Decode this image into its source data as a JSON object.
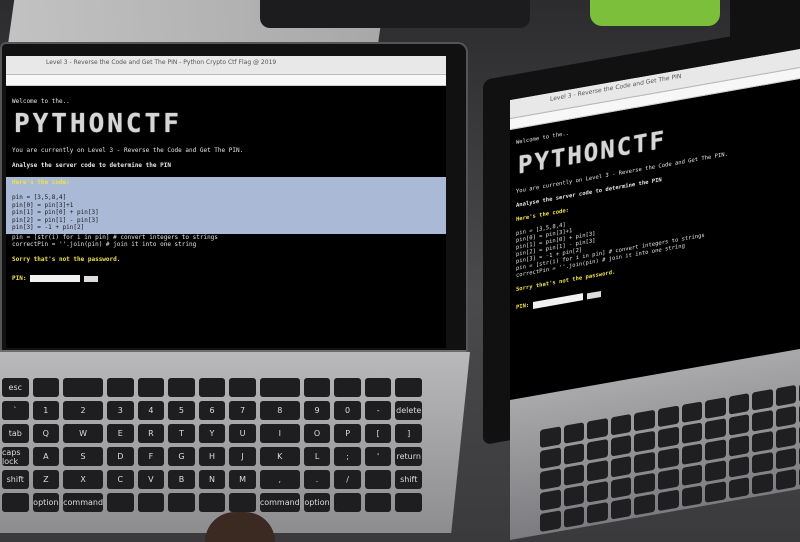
{
  "left_screen": {
    "tab_title": "Level 3 - Reverse the Code and Get The PIN - Python Crypto Ctf Flag @ 2019",
    "welcome": "Welcome to the..",
    "banner": "PYTHONCTF",
    "level_line": "You are currently on Level 3 - Reverse the Code and Get The PIN.",
    "analyse_line": "Analyse the server code to determine the PIN",
    "code_header": "Here's the code:",
    "code_lines": [
      "pin = [3,5,8,4]",
      "pin[0] = pin[3]+1",
      "pin[1] = pin[0] + pin[3]",
      "pin[2] = pin[1] - pin[3]",
      "pin[3] = -1 + pin[2]",
      "pin = [str(i) for i in pin] # convert integers to strings",
      "correctPin = ''.join(pin) # join it into one string"
    ],
    "status": "Sorry that's not the password.",
    "pin_label": "PIN:"
  },
  "right_screen": {
    "tab_title": "Level 3 - Reverse the Code and Get The PIN",
    "welcome": "Welcome to the..",
    "banner": "PYTHONCTF",
    "level_line": "You are currently on Level 3 - Reverse the Code and Get The PIN.",
    "analyse_line": "Analyse the server code to determine the PIN",
    "code_header": "Here's the code:",
    "code_lines": [
      "pin = [3,5,8,4]",
      "pin[0] = pin[3]+1",
      "pin[1] = pin[0] + pin[3]",
      "pin[2] = pin[1] - pin[3]",
      "pin[3] = -1 + pin[2]",
      "pin = [str(i) for i in pin] # convert integers to strings",
      "correctPin = ''.join(pin) # join it into one string"
    ],
    "status": "Sorry that's not the password.",
    "pin_label": "PIN:"
  },
  "left_keyboard": {
    "keys": [
      "esc",
      "",
      "",
      "",
      "",
      "",
      "",
      "",
      "",
      "",
      "",
      "",
      "",
      "`",
      "1",
      "2",
      "3",
      "4",
      "5",
      "6",
      "7",
      "8",
      "9",
      "0",
      "-",
      "delete",
      "tab",
      "Q",
      "W",
      "E",
      "R",
      "T",
      "Y",
      "U",
      "I",
      "O",
      "P",
      "[",
      "]",
      "caps lock",
      "A",
      "S",
      "D",
      "F",
      "G",
      "H",
      "J",
      "K",
      "L",
      ";",
      "'",
      "return",
      "shift",
      "Z",
      "X",
      "C",
      "V",
      "B",
      "N",
      "M",
      ",",
      ".",
      "/",
      "",
      "shift",
      "",
      "option",
      "command",
      "",
      "",
      "",
      "",
      "",
      "command",
      "option",
      "",
      "",
      ""
    ]
  },
  "colors": {
    "terminal_bg": "#000000",
    "terminal_text": "#e6e6e6",
    "highlight_text": "#f0e24a",
    "selection": "#a9b9d6"
  }
}
